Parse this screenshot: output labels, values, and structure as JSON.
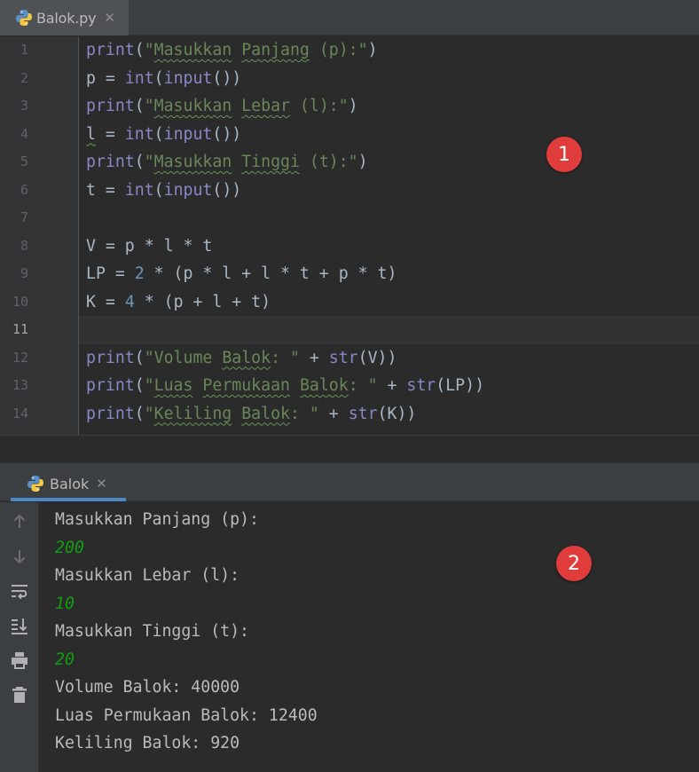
{
  "editor": {
    "tab": {
      "label": "Balok.py",
      "icon": "python-file-icon",
      "close_icon": "close-icon"
    },
    "current_line": 11,
    "lines": [
      {
        "num": "1",
        "tokens": [
          {
            "t": "print",
            "c": "kw"
          },
          {
            "t": "(",
            "c": ""
          },
          {
            "t": "\"",
            "c": "str"
          },
          {
            "t": "Masukkan",
            "c": "str",
            "u": true
          },
          {
            "t": " ",
            "c": "str"
          },
          {
            "t": "Panjang",
            "c": "str",
            "u": true
          },
          {
            "t": " (p):\"",
            "c": "str"
          },
          {
            "t": ")",
            "c": ""
          }
        ]
      },
      {
        "num": "2",
        "tokens": [
          {
            "t": "p = ",
            "c": ""
          },
          {
            "t": "int",
            "c": "kw"
          },
          {
            "t": "(",
            "c": ""
          },
          {
            "t": "input",
            "c": "kw"
          },
          {
            "t": "())",
            "c": ""
          }
        ]
      },
      {
        "num": "3",
        "tokens": [
          {
            "t": "print",
            "c": "kw"
          },
          {
            "t": "(",
            "c": ""
          },
          {
            "t": "\"",
            "c": "str"
          },
          {
            "t": "Masukkan",
            "c": "str",
            "u": true
          },
          {
            "t": " ",
            "c": "str"
          },
          {
            "t": "Lebar",
            "c": "str",
            "u": true
          },
          {
            "t": " (l):\"",
            "c": "str"
          },
          {
            "t": ")",
            "c": ""
          }
        ]
      },
      {
        "num": "4",
        "tokens": [
          {
            "t": "l",
            "c": "",
            "u": true
          },
          {
            "t": " = ",
            "c": ""
          },
          {
            "t": "int",
            "c": "kw"
          },
          {
            "t": "(",
            "c": ""
          },
          {
            "t": "input",
            "c": "kw"
          },
          {
            "t": "())",
            "c": ""
          }
        ]
      },
      {
        "num": "5",
        "tokens": [
          {
            "t": "print",
            "c": "kw"
          },
          {
            "t": "(",
            "c": ""
          },
          {
            "t": "\"",
            "c": "str"
          },
          {
            "t": "Masukkan",
            "c": "str",
            "u": true
          },
          {
            "t": " ",
            "c": "str"
          },
          {
            "t": "Tinggi",
            "c": "str",
            "u": true
          },
          {
            "t": " (t):\"",
            "c": "str"
          },
          {
            "t": ")",
            "c": ""
          }
        ]
      },
      {
        "num": "6",
        "tokens": [
          {
            "t": "t = ",
            "c": ""
          },
          {
            "t": "int",
            "c": "kw"
          },
          {
            "t": "(",
            "c": ""
          },
          {
            "t": "input",
            "c": "kw"
          },
          {
            "t": "())",
            "c": ""
          }
        ]
      },
      {
        "num": "7",
        "tokens": []
      },
      {
        "num": "8",
        "tokens": [
          {
            "t": "V = p * l * t",
            "c": ""
          }
        ]
      },
      {
        "num": "9",
        "tokens": [
          {
            "t": "LP = ",
            "c": ""
          },
          {
            "t": "2",
            "c": "num"
          },
          {
            "t": " * (p * l + l * t + p * t)",
            "c": ""
          }
        ]
      },
      {
        "num": "10",
        "tokens": [
          {
            "t": "K = ",
            "c": ""
          },
          {
            "t": "4",
            "c": "num"
          },
          {
            "t": " * (p + l + t)",
            "c": ""
          }
        ]
      },
      {
        "num": "11",
        "tokens": []
      },
      {
        "num": "12",
        "tokens": [
          {
            "t": "print",
            "c": "kw"
          },
          {
            "t": "(",
            "c": ""
          },
          {
            "t": "\"Volume ",
            "c": "str"
          },
          {
            "t": "Balok",
            "c": "str",
            "u": true
          },
          {
            "t": ": \"",
            "c": "str"
          },
          {
            "t": " + ",
            "c": ""
          },
          {
            "t": "str",
            "c": "kw"
          },
          {
            "t": "(V))",
            "c": ""
          }
        ]
      },
      {
        "num": "13",
        "tokens": [
          {
            "t": "print",
            "c": "kw"
          },
          {
            "t": "(",
            "c": ""
          },
          {
            "t": "\"",
            "c": "str"
          },
          {
            "t": "Luas",
            "c": "str",
            "u": true
          },
          {
            "t": " ",
            "c": "str"
          },
          {
            "t": "Permukaan",
            "c": "str",
            "u": true
          },
          {
            "t": " ",
            "c": "str"
          },
          {
            "t": "Balok",
            "c": "str",
            "u": true
          },
          {
            "t": ": \"",
            "c": "str"
          },
          {
            "t": " + ",
            "c": ""
          },
          {
            "t": "str",
            "c": "kw"
          },
          {
            "t": "(LP))",
            "c": ""
          }
        ]
      },
      {
        "num": "14",
        "tokens": [
          {
            "t": "print",
            "c": "kw"
          },
          {
            "t": "(",
            "c": ""
          },
          {
            "t": "\"",
            "c": "str"
          },
          {
            "t": "Keliling",
            "c": "str",
            "u": true
          },
          {
            "t": " ",
            "c": "str"
          },
          {
            "t": "Balok",
            "c": "str",
            "u": true
          },
          {
            "t": ": \"",
            "c": "str"
          },
          {
            "t": " + ",
            "c": ""
          },
          {
            "t": "str",
            "c": "kw"
          },
          {
            "t": "(K))",
            "c": ""
          }
        ]
      }
    ]
  },
  "run": {
    "tab": {
      "label": "Balok",
      "icon": "python-icon",
      "close_icon": "close-icon"
    },
    "toolbar": [
      {
        "name": "rerun-up-icon",
        "glyph": "up"
      },
      {
        "name": "scroll-down-icon",
        "glyph": "down"
      },
      {
        "name": "soft-wrap-icon",
        "glyph": "wrap"
      },
      {
        "name": "scroll-to-end-icon",
        "glyph": "end"
      },
      {
        "name": "print-icon",
        "glyph": "print"
      },
      {
        "name": "trash-icon",
        "glyph": "trash"
      }
    ],
    "output": [
      {
        "text": "Masukkan Panjang (p):",
        "kind": "out"
      },
      {
        "text": "200",
        "kind": "in"
      },
      {
        "text": "Masukkan Lebar (l):",
        "kind": "out"
      },
      {
        "text": "10",
        "kind": "in"
      },
      {
        "text": "Masukkan Tinggi (t):",
        "kind": "out"
      },
      {
        "text": "20",
        "kind": "in"
      },
      {
        "text": "Volume Balok: 40000",
        "kind": "out"
      },
      {
        "text": "Luas Permukaan Balok: 12400",
        "kind": "out"
      },
      {
        "text": "Keliling Balok: 920",
        "kind": "out"
      }
    ]
  },
  "badges": [
    "1",
    "2"
  ],
  "colors": {
    "keyword": "#8888c6",
    "string": "#6a8759",
    "number": "#6897bb",
    "input_text": "#119e11",
    "badge": "#e03c3c",
    "tab_accent": "#4a88c7"
  }
}
